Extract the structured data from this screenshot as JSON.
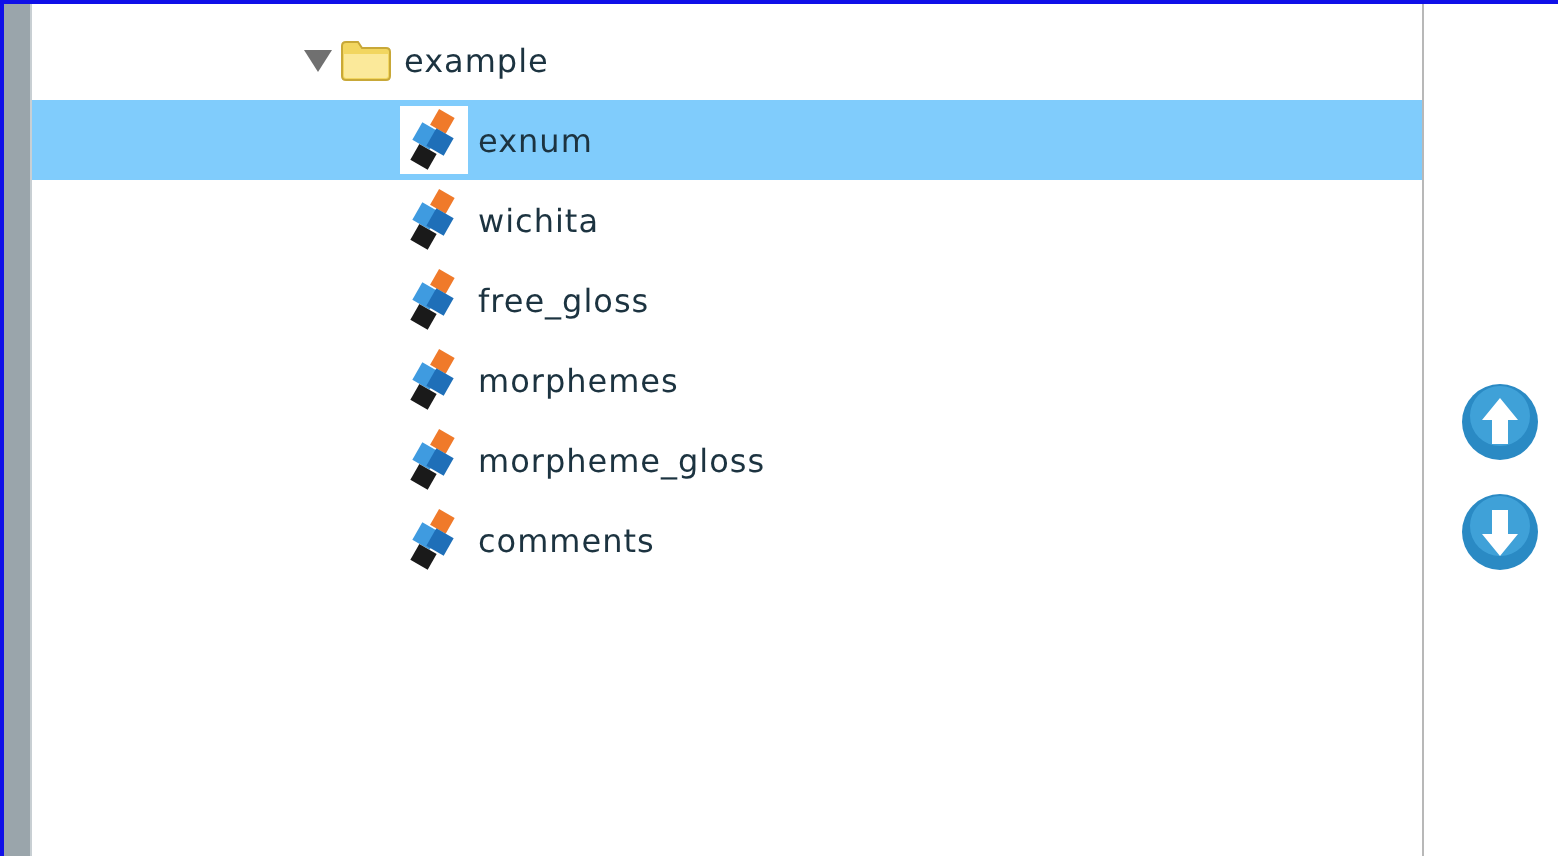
{
  "tree": {
    "label": "example",
    "expanded": true,
    "children": [
      {
        "label": "exnum",
        "selected": true
      },
      {
        "label": "wichita",
        "selected": false
      },
      {
        "label": "free_gloss",
        "selected": false
      },
      {
        "label": "morphemes",
        "selected": false
      },
      {
        "label": "morpheme_gloss",
        "selected": false
      },
      {
        "label": "comments",
        "selected": false
      }
    ]
  },
  "buttons": [
    {
      "kind": "up"
    },
    {
      "kind": "down"
    }
  ]
}
